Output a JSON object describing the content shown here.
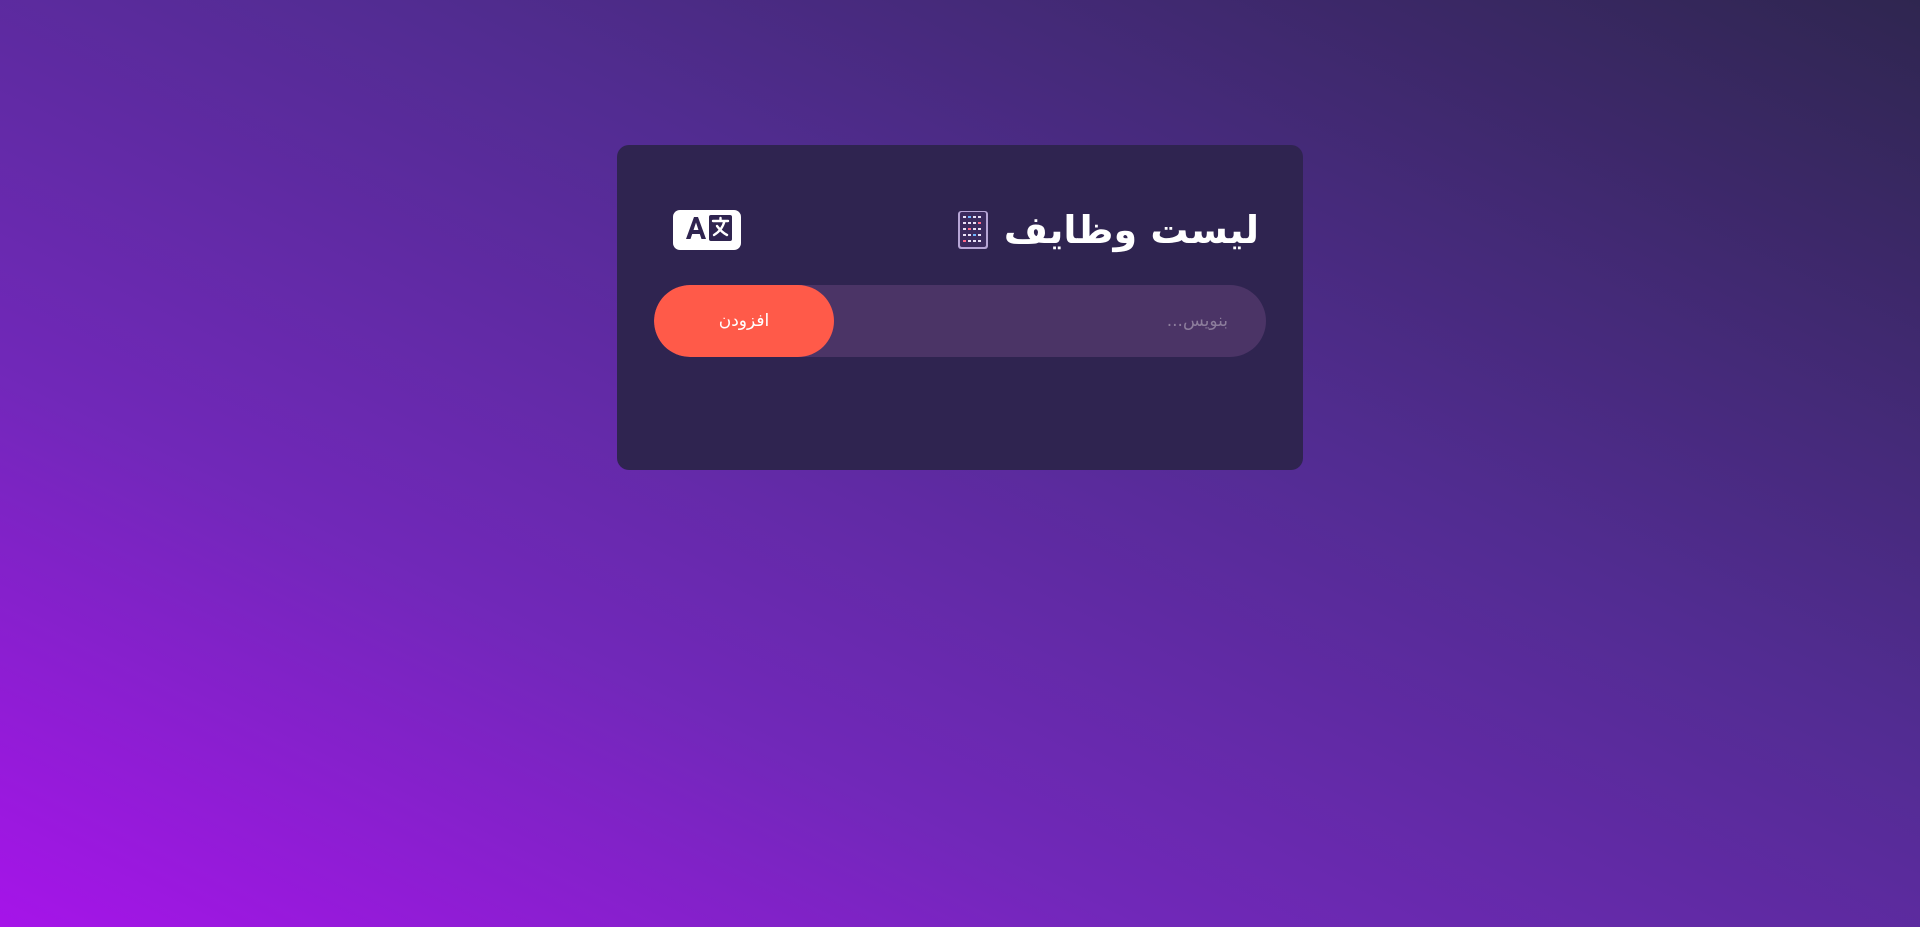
{
  "app": {
    "title": "لیست وظایف",
    "title_icon": "notebook-icon",
    "language_toggle_icon": "translate-icon"
  },
  "form": {
    "input_value": "",
    "input_placeholder": "بنویس...",
    "add_label": "افزودن"
  },
  "colors": {
    "card_background": "#2f2450",
    "input_background": "#4b3466",
    "accent": "#ff5a49",
    "gradient_start": "#a614e9",
    "gradient_end": "#2f2650"
  }
}
